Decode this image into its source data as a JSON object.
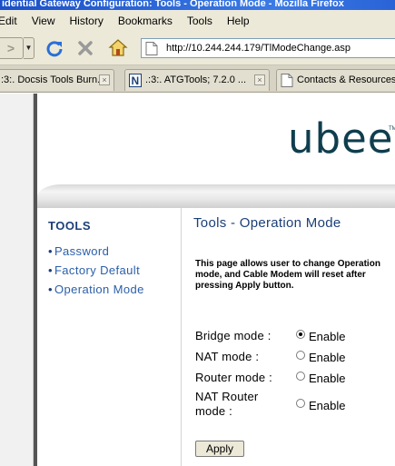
{
  "window": {
    "title": "idential Gateway Configuration: Tools - Operation Mode - Mozilla Firefox"
  },
  "menubar": {
    "items": [
      "Edit",
      "View",
      "History",
      "Bookmarks",
      "Tools",
      "Help"
    ]
  },
  "navbar": {
    "url": "http://10.244.244.179/TlModeChange.asp",
    "forward_icon": "forward-arrow-icon",
    "reload_icon": "reload-icon",
    "stop_icon": "stop-icon",
    "home_icon": "home-icon"
  },
  "tabs": [
    {
      "label": ":3:. Docsis Tools Burn...",
      "close": "×"
    },
    {
      "label": ".:3:. ATGTools; 7.2.0 ...",
      "close": "×"
    },
    {
      "label": "Contacts & Resources",
      "close": "×"
    }
  ],
  "page": {
    "logo_text": "ubee",
    "logo_tm": "TM",
    "sidebar": {
      "title": "TOOLS",
      "links": [
        "Password",
        "Factory Default",
        "Operation Mode"
      ]
    },
    "main": {
      "title": "Tools - Operation Mode",
      "description": "This page allows user to change Operation mode, and Cable Modem will reset after pressing Apply button.",
      "options": [
        {
          "label": "Bridge mode :",
          "option": "Enable",
          "checked": true
        },
        {
          "label": "NAT mode :",
          "option": "Enable",
          "checked": false
        },
        {
          "label": "Router mode :",
          "option": "Enable",
          "checked": false
        },
        {
          "label": "NAT Router",
          "label2": "mode :",
          "option": "Enable",
          "checked": false
        }
      ],
      "apply_label": "Apply"
    }
  },
  "colors": {
    "title_bar": "#2a63d6",
    "chrome": "#ece9d8",
    "nav_title": "#1c3f78",
    "nav_link": "#2b5fa8",
    "logo": "#0f3e4e"
  }
}
